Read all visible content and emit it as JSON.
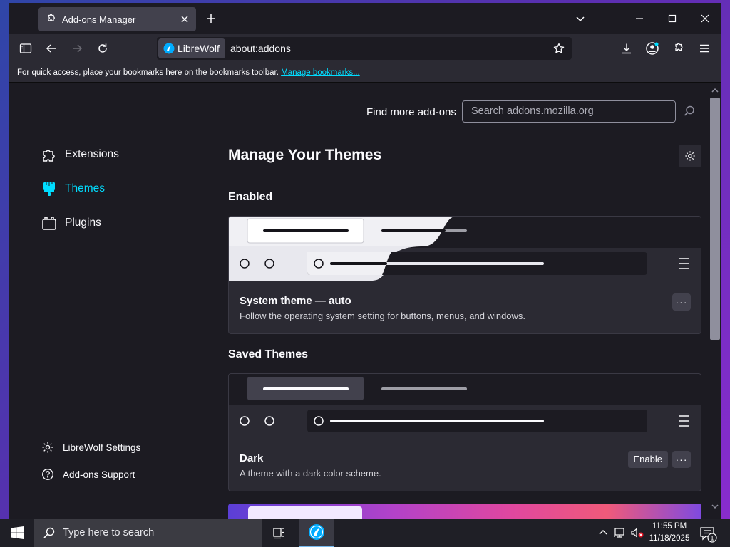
{
  "browser": {
    "tab_title": "Add-ons Manager",
    "identity_label": "LibreWolf",
    "url": "about:addons",
    "bookmarks_message": "For quick access, place your bookmarks here on the bookmarks toolbar.",
    "bookmarks_link": "Manage bookmarks..."
  },
  "page": {
    "find_more_label": "Find more add-ons",
    "search_placeholder": "Search addons.mozilla.org",
    "heading": "Manage Your Themes",
    "sidebar": {
      "items": [
        {
          "label": "Extensions",
          "icon": "puzzle-icon",
          "active": false
        },
        {
          "label": "Themes",
          "icon": "brush-icon",
          "active": true
        },
        {
          "label": "Plugins",
          "icon": "plugin-icon",
          "active": false
        }
      ],
      "footer": [
        {
          "label": "LibreWolf Settings",
          "icon": "gear-icon"
        },
        {
          "label": "Add-ons Support",
          "icon": "help-icon"
        }
      ]
    },
    "sections": {
      "enabled_title": "Enabled",
      "saved_title": "Saved Themes"
    },
    "themes": {
      "system": {
        "name": "System theme — auto",
        "description": "Follow the operating system setting for buttons, menus, and windows.",
        "more_label": "···"
      },
      "dark": {
        "name": "Dark",
        "description": "A theme with a dark color scheme.",
        "enable_label": "Enable",
        "more_label": "···"
      }
    }
  },
  "taskbar": {
    "search_placeholder": "Type here to search",
    "time": "11:55 PM",
    "date": "11/18/2025",
    "notification_count": "1"
  },
  "colors": {
    "accent": "#00ddff",
    "window_bg": "#1c1b22",
    "toolbar_bg": "#2b2a33"
  }
}
